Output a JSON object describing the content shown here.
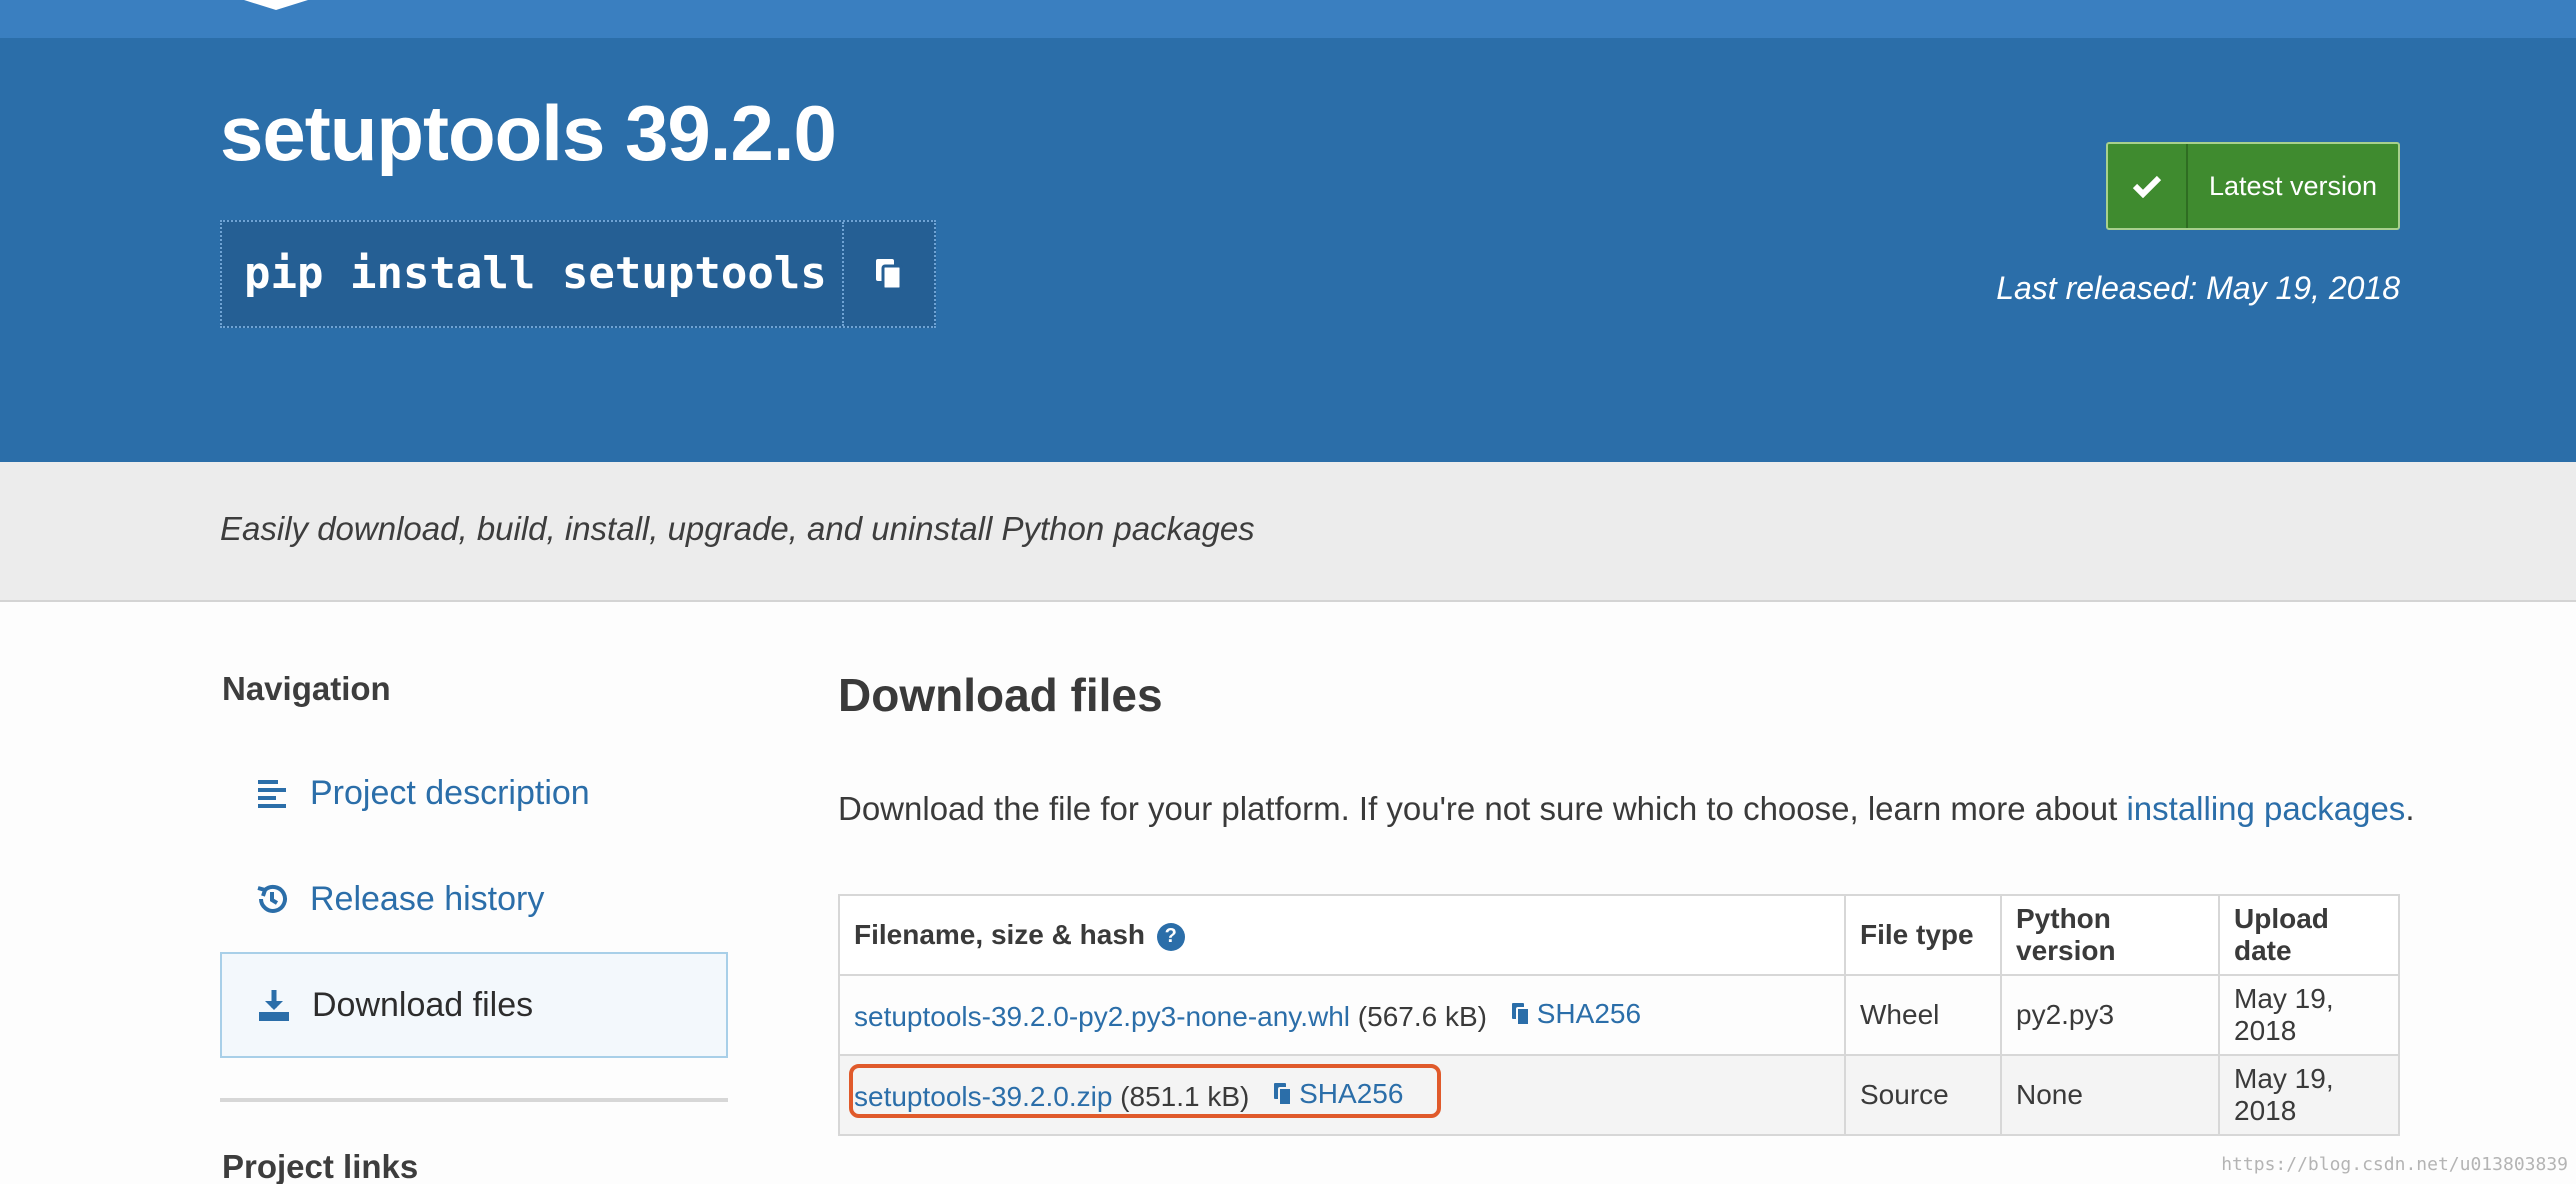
{
  "hero": {
    "title": "setuptools 39.2.0",
    "pip_command": "pip install setuptools",
    "latest_label": "Latest version",
    "released": "Last released: May 19, 2018"
  },
  "summary": "Easily download, build, install, upgrade, and uninstall Python packages",
  "nav": {
    "heading": "Navigation",
    "items": [
      {
        "label": "Project description",
        "icon": "align-left-icon"
      },
      {
        "label": "Release history",
        "icon": "history-icon"
      },
      {
        "label": "Download files",
        "icon": "download-icon",
        "active": true
      }
    ],
    "links_heading": "Project links"
  },
  "main": {
    "heading": "Download files",
    "intro": "Download the file for your platform. If you're not sure which to choose, learn more about ",
    "intro_link": "installing packages",
    "intro_end": ".",
    "table": {
      "headers": [
        "Filename, size & hash",
        "File type",
        "Python version",
        "Upload date"
      ],
      "rows": [
        {
          "filename": "setuptools-39.2.0-py2.py3-none-any.whl",
          "size": "(567.6 kB)",
          "hash": "SHA256",
          "type": "Wheel",
          "python": "py2.py3",
          "date": "May 19, 2018"
        },
        {
          "filename": "setuptools-39.2.0.zip",
          "size": "(851.1 kB)",
          "hash": "SHA256",
          "type": "Source",
          "python": "None",
          "date": "May 19, 2018"
        }
      ]
    }
  },
  "watermark": "https://blog.csdn.net/u013803839",
  "colors": {
    "hero": "#2b6ea9",
    "latest": "#3f8b2f",
    "link": "#2b6ea9",
    "highlight": "#e05a2b"
  }
}
